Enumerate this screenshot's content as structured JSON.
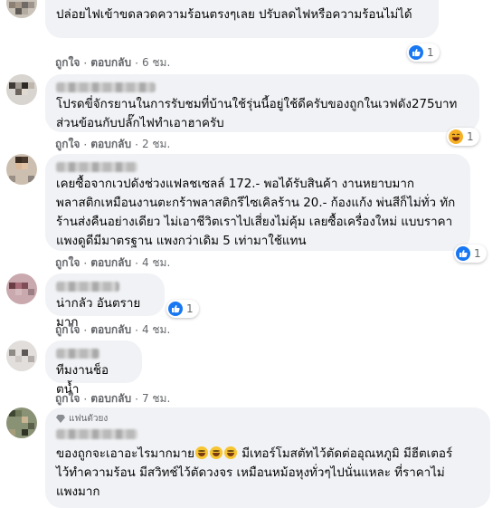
{
  "comments": [
    {
      "text": "ปล่อยไฟเข้าขดลวดความร้อนตรงๆเลย ปรับลดไฟหรือความร้อนไม่ได้",
      "like_label": "ถูกใจ",
      "reply_label": "ตอบกลับ",
      "time": "6 ชม.",
      "reaction": {
        "type": "like",
        "count": "1"
      }
    },
    {
      "text": "โปรดขี่จักรยานในการรับชมที่บ้านใช้รุ่นนี้อยู่ใช้ดีครับของถูกในเวฟดัง275บาท\nส่วนข้อนกับปลั๊กไฟทำเอาฮาครับ",
      "like_label": "ถูกใจ",
      "reply_label": "ตอบกลับ",
      "time": "2 ชม.",
      "reaction": {
        "type": "haha",
        "count": "1"
      }
    },
    {
      "text": "เคยซื้อจากเวปดังช่วงแฟลชเซลล์ 172.- พอได้รับสินค้า งานหยาบมาก\nพลาสติกเหมือนงานตะกร้าพลาสติกรีไซเคิลร้าน 20.- ก้องแก้ง พ่นสีก็ไม่ทั่ว ทัก\nร้านส่งคืนอย่างเดียว ไม่เอาชีวิตเราไปเสี่ยงไม่คุ้ม เลยซื้อเครื่องใหม่ แบบราคา\nแพงดูดีมีมาตรฐาน แพงกว่าเดิม 5 เท่ามาใช้แทน",
      "like_label": "ถูกใจ",
      "reply_label": "ตอบกลับ",
      "time": "4 ชม.",
      "reaction": {
        "type": "like",
        "count": "1"
      }
    },
    {
      "text": "น่ากลัว อันตรายมาก",
      "like_label": "ถูกใจ",
      "reply_label": "ตอบกลับ",
      "time": "4 ชม.",
      "reaction": {
        "type": "like",
        "count": "1"
      }
    },
    {
      "text": "ทีมงานช็อตน้ำ",
      "like_label": "ถูกใจ",
      "reply_label": "ตอบกลับ",
      "time": "7 ชม."
    },
    {
      "badge": "แฟนตัวยง",
      "text_parts": [
        "ของถูกจะเอาอะไรมากมาย",
        " มีเทอร์โมสตัทไว้ตัดต่ออุณหภูมิ มีฮีตเตอร์",
        "ไว้ทำความร้อน มีสวิทช์ไว้ตัดวงจร เหมือนหม้อหุงทั่วๆไปนั่นแหละ ที่ราคาไม่",
        "แพงมาก"
      ]
    }
  ],
  "icons": {
    "like": "like-thumb-icon",
    "haha": "haha-emoji-icon",
    "fan": "diamond-badge-icon",
    "emoji": "grinning-sweat-emoji-icon"
  },
  "colors": {
    "bubble": "#f0f2f5",
    "like_blue": "#1877f2",
    "meta_gray": "#65676b",
    "text": "#050505"
  }
}
